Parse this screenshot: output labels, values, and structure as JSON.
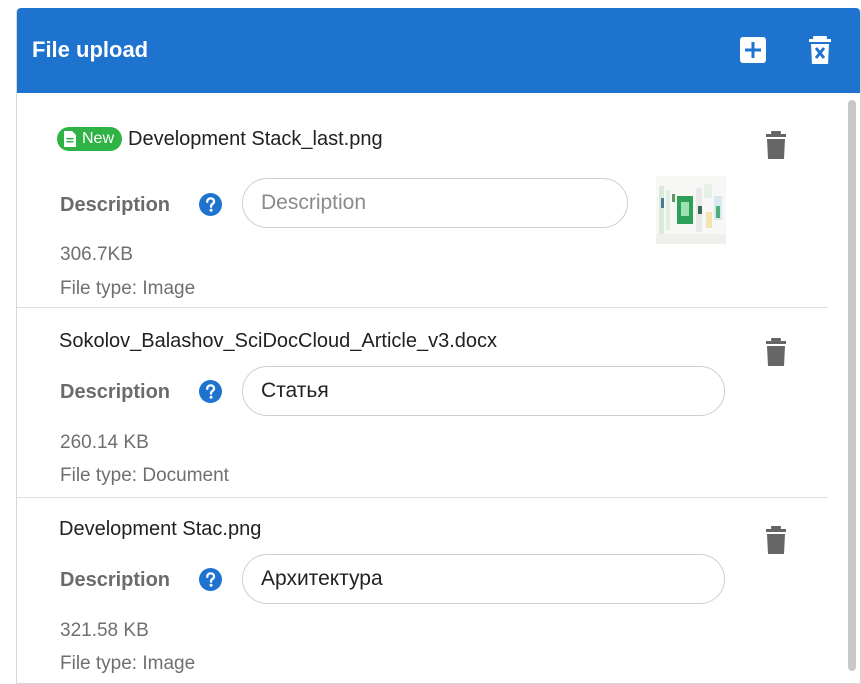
{
  "header": {
    "title": "File upload",
    "add_icon": "plus-square-icon",
    "delete_all_icon": "trash-x-icon",
    "color": "#1e73cf"
  },
  "files": [
    {
      "badge": "New",
      "name": "Development Stack_last.png",
      "description_label": "Description",
      "description_value": "",
      "description_placeholder": "Description",
      "size": "306.7KB",
      "file_type": "File type: Image",
      "has_thumbnail": true
    },
    {
      "name": "Sokolov_Balashov_SciDocCloud_Article_v3.docx",
      "description_label": "Description",
      "description_value": "Статья",
      "size": "260.14 KB",
      "file_type": "File type: Document"
    },
    {
      "name": "Development Stac.png",
      "description_label": "Description",
      "description_value": "Архитектура",
      "size": "321.58 KB",
      "file_type": "File type: Image"
    }
  ],
  "colors": {
    "badge": "#2fb344",
    "help": "#1e73cf",
    "trash": "#666666"
  }
}
